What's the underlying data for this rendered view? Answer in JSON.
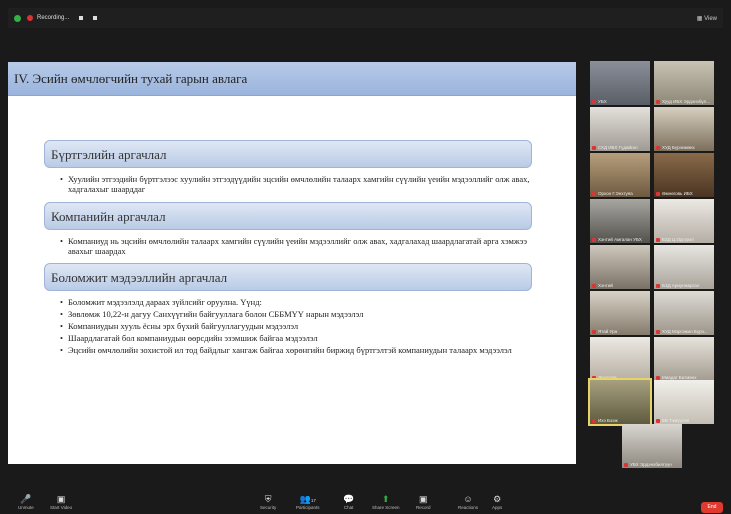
{
  "topbar": {
    "recording_label": "Recording...",
    "view_label": "View"
  },
  "slide": {
    "title": "IV. Эсийн өмчлөгчийн тухай гарын авлага",
    "sections": [
      {
        "heading": "Бүртгэлийн аргачлал",
        "bullets": [
          "Хуулийн этгээдийн бүртгэлээс хуулийн этгээдүүдийн эцсийн өмчлөлийн талаарх хамгийн сүүлийн үеийн мэдээллийг олж авах, хадгалахыг шаарддаг"
        ]
      },
      {
        "heading": "Компанийн аргачлал",
        "bullets": [
          "Компаниуд нь эцсийн өмчлөлийн талаарх хамгийн сүүлийн үеийн мэдээллийг олж авах, хадгалахад шаардлагатай арга хэмжээ авахыг шаардах"
        ]
      },
      {
        "heading": "Боломжит мэдээллийн аргачлал",
        "bullets": [
          "Боломжит мэдээлэлд дараах зүйлсийг оруулна. Үүнд:",
          "Зөвлөмж 10,22-н дагуу Санхүүгийн байгууллага болон СББМҮҮ нарын мэдээлэл",
          "Компаниудын хууль ёсны эрх бүхий байгууллагуудын мэдээлэл",
          "Шаардлагатай бол компаниудын өөрсдийн эзэмшиж байгаа мэдээлэл",
          "Эцсийн өмчлөлийн зохистой ил тод байдлыг хангаж байгаа хөрөнгийн биржид бүртгэлтэй компаниудын талаарх мэдээлэл"
        ]
      }
    ]
  },
  "participants": [
    {
      "name": "УБХ"
    },
    {
      "name": "Хууд ИБХ Эрдэнэбүл..."
    },
    {
      "name": "СХД ИБХ Гүдайгал"
    },
    {
      "name": "ХУД Бүрэнмөнх"
    },
    {
      "name": "Орхон Г.Энхтуяа"
    },
    {
      "name": "Өмнөговь ИБХ"
    },
    {
      "name": "Хэнтий Амгалан УБХ"
    },
    {
      "name": "БЗД Ц.Одгэрэл"
    },
    {
      "name": "Хэнтий"
    },
    {
      "name": "БЗД Ариунжаргал"
    },
    {
      "name": "Ятай Ура"
    },
    {
      "name": "ХУД Мэргэжил Бүрэ..."
    },
    {
      "name": "Дундговь"
    },
    {
      "name": "Миадаг Батмөнх"
    },
    {
      "name": "Ихэ Бээж"
    },
    {
      "name": "ЕБ Тэмүүлэл"
    },
    {
      "name": "УБХ Эрдэнэбилгүүн"
    }
  ],
  "toolbar": {
    "unmute": "Unmute",
    "start_video": "Start Video",
    "security": "Security",
    "participants": "Participants",
    "participants_count": "17",
    "chat": "Chat",
    "share_screen": "Share Screen",
    "record": "Record",
    "reactions": "Reactions",
    "apps": "Apps",
    "end": "End"
  },
  "colors": {
    "header_gradient_top": "#b8cbe8",
    "band_gradient_top": "#dfe7f4",
    "end_red": "#e03a2f",
    "share_green": "#2fb344"
  }
}
